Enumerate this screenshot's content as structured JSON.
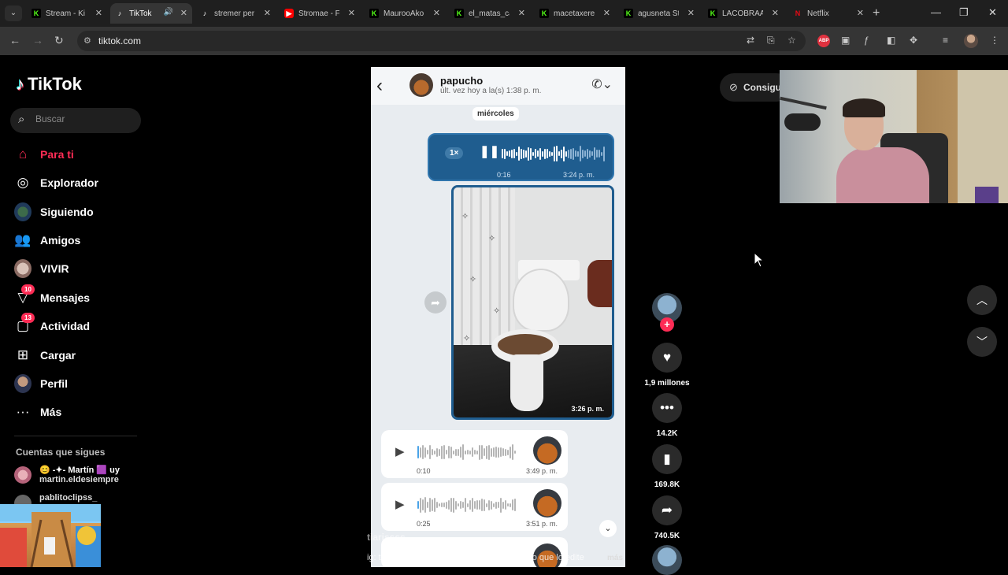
{
  "browser": {
    "tabs": [
      {
        "label": "Stream - Ki",
        "favicon": "kick-icon"
      },
      {
        "label": "TikTok",
        "favicon": "tiktok-icon",
        "active": true,
        "audio": true
      },
      {
        "label": "stremer per",
        "favicon": "tiktok-icon"
      },
      {
        "label": "Stromae - F",
        "favicon": "youtube-icon"
      },
      {
        "label": "MaurooAko",
        "favicon": "kick-icon"
      },
      {
        "label": "el_matas_ca",
        "favicon": "kick-icon"
      },
      {
        "label": "macetaxere",
        "favicon": "kick-icon"
      },
      {
        "label": "agusneta St",
        "favicon": "kick-icon"
      },
      {
        "label": "LACOBRAA",
        "favicon": "kick-icon"
      },
      {
        "label": "Netflix",
        "favicon": "netflix-icon"
      }
    ],
    "url": "tiktok.com"
  },
  "sidebar": {
    "logo_text": "TikTok",
    "search_placeholder": "Buscar",
    "nav": [
      {
        "label": "Para ti",
        "icon": "home-icon",
        "active": true
      },
      {
        "label": "Explorador",
        "icon": "compass-icon"
      },
      {
        "label": "Siguiendo",
        "icon": "following-avatar"
      },
      {
        "label": "Amigos",
        "icon": "friends-icon"
      },
      {
        "label": "VIVIR",
        "icon": "live-avatar"
      },
      {
        "label": "Mensajes",
        "icon": "messages-icon",
        "badge": "10"
      },
      {
        "label": "Actividad",
        "icon": "activity-icon",
        "badge": "13"
      },
      {
        "label": "Cargar",
        "icon": "upload-icon"
      },
      {
        "label": "Perfil",
        "icon": "profile-avatar"
      },
      {
        "label": "Más",
        "icon": "more-icon"
      }
    ],
    "following_title": "Cuentas que sigues",
    "following": [
      {
        "name": "Martín",
        "prefix": "😊 -✦-",
        "suffix": "🟪 uy",
        "username": "martin.eldesiempre"
      },
      {
        "name": "",
        "prefix": "",
        "suffix": "",
        "username": "pablitoclipss_"
      }
    ]
  },
  "video": {
    "chat": {
      "contact_name": "papucho",
      "last_seen": "últ. vez hoy a la(s) 1:38 p. m.",
      "day_label": "miércoles",
      "sent_audio": {
        "speed": "1×",
        "duration": "0:16",
        "time": "3:24 p. m."
      },
      "image_time": "3:26 p. m.",
      "received_audio": [
        {
          "duration": "0:10",
          "time": "3:49 p. m."
        },
        {
          "duration": "0:25",
          "time": "3:51 p. m."
        }
      ]
    },
    "caption_user": "tiarissss",
    "caption_text": "ig: tiari y papucho / JAJAJAJAJAJA es obvio que lo edite",
    "caption_more": "más"
  },
  "actions": {
    "likes": "1,9 millones",
    "comments": "14.2K",
    "saves": "169.8K",
    "shares": "740.5K"
  },
  "promo_label": "Consigue"
}
